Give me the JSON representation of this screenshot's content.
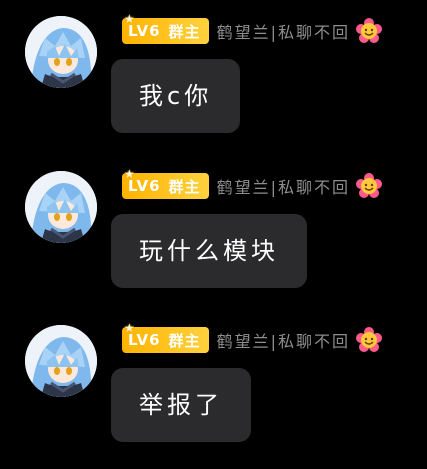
{
  "messages": [
    {
      "badge": {
        "level": "LV6",
        "role": "群主"
      },
      "nickname": "鹤望兰|私聊不回",
      "text": "我c你",
      "emoji_icon": "flower-emoji-icon"
    },
    {
      "badge": {
        "level": "LV6",
        "role": "群主"
      },
      "nickname": "鹤望兰|私聊不回",
      "text": "玩什么模块",
      "emoji_icon": "flower-emoji-icon"
    },
    {
      "badge": {
        "level": "LV6",
        "role": "群主"
      },
      "nickname": "鹤望兰|私聊不回",
      "text": "举报了",
      "emoji_icon": "flower-emoji-icon"
    }
  ],
  "colors": {
    "background": "#000000",
    "bubble": "#2b2b2d",
    "badge_gold": "#ffc21a",
    "nickname_gray": "#8e8e8e"
  }
}
